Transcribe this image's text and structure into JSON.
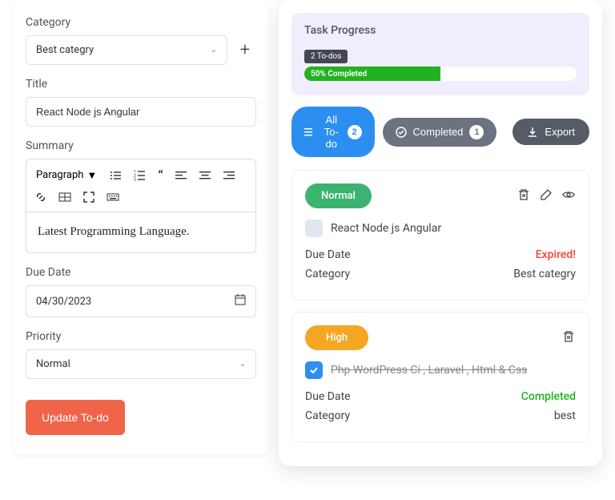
{
  "form": {
    "category": {
      "label": "Category",
      "value": "Best categry"
    },
    "title": {
      "label": "Title",
      "value": "React Node js Angular"
    },
    "summary": {
      "label": "Summary",
      "paragraph_selector": "Paragraph",
      "body": "Latest Programming Language."
    },
    "due_date": {
      "label": "Due Date",
      "value": "04/30/2023"
    },
    "priority": {
      "label": "Priority",
      "value": "Normal"
    },
    "update_button": "Update To-do"
  },
  "right": {
    "progress": {
      "title": "Task Progress",
      "todos_badge": "2 To-dos",
      "percent_text": "50%",
      "percent_label": "Completed",
      "fill_width": "50%"
    },
    "tabs": {
      "all": {
        "label": "All To-do",
        "count": "2"
      },
      "completed": {
        "label": "Completed",
        "count": "1"
      },
      "export": {
        "label": "Export"
      }
    },
    "tasks": [
      {
        "priority_label": "Normal",
        "priority_class": "badge-green",
        "checked": false,
        "title": "React Node js Angular",
        "due_label": "Due Date",
        "due_value": "Expired!",
        "due_class": "val-expired",
        "cat_label": "Category",
        "cat_value": "Best categry",
        "show_edit_view": true
      },
      {
        "priority_label": "High",
        "priority_class": "badge-orange",
        "checked": true,
        "title": "Php WordPress Ci , Laravel , Html & Css",
        "due_label": "Due Date",
        "due_value": "Completed",
        "due_class": "val-completed",
        "cat_label": "Category",
        "cat_value": "best",
        "show_edit_view": false
      }
    ]
  },
  "colors": {
    "accent_blue": "#2b8ef0",
    "accent_green": "#22b221",
    "accent_orange": "#f5a623",
    "accent_red": "#f44336",
    "btn_coral": "#f06449"
  }
}
